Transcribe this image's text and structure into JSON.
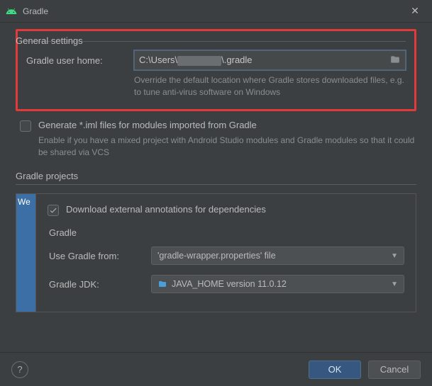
{
  "window": {
    "title": "Gradle"
  },
  "general": {
    "section_title": "General settings",
    "home_label": "Gradle user home:",
    "home_value_prefix": "C:\\Users\\",
    "home_value_suffix": "\\.gradle",
    "home_hint": "Override the default location where Gradle stores downloaded files, e.g. to tune anti-virus software on Windows",
    "iml_label": "Generate *.iml files for modules imported from Gradle",
    "iml_hint": "Enable if you have a mixed project with Android Studio modules and Gradle modules so that it could be shared via VCS"
  },
  "projects": {
    "section_title": "Gradle projects",
    "list_item": "We",
    "download_label": "Download external annotations for dependencies",
    "sub_title": "Gradle",
    "use_from_label": "Use Gradle from:",
    "use_from_value": "'gradle-wrapper.properties' file",
    "jdk_label": "Gradle JDK:",
    "jdk_value": "JAVA_HOME version 11.0.12"
  },
  "footer": {
    "ok": "OK",
    "cancel": "Cancel",
    "help": "?"
  }
}
